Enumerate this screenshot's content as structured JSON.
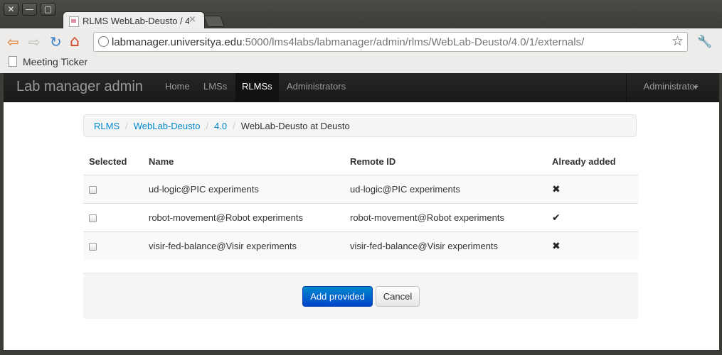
{
  "window": {
    "close_glyph": "✕",
    "minimize_glyph": "—",
    "maximize_glyph": "▢"
  },
  "tab": {
    "title": "RLMS WebLab-Deusto / 4.",
    "close_glyph": "×"
  },
  "toolbar": {
    "back_glyph": "⇦",
    "forward_glyph": "⇨",
    "reload_glyph": "↻",
    "home_glyph": "⌂",
    "url_host": "labmanager.universitya.edu",
    "url_path": ":5000/lms4labs/labmanager/admin/rlms/WebLab-Deusto/4.0/1/externals/",
    "star_glyph": "☆",
    "wrench_glyph": "🔧",
    "icons": [
      "back-arrow-icon",
      "forward-arrow-icon",
      "reload-icon",
      "home-icon",
      "globe-icon",
      "star-icon",
      "wrench-icon"
    ],
    "colors": {
      "back": "#e0792a",
      "forward": "#bdbdb8",
      "reload": "#3a7ec6",
      "home": "#d04a2a"
    }
  },
  "bookmarks": [
    {
      "label": "Meeting Ticker",
      "icon": "page-icon"
    }
  ],
  "navbar": {
    "brand": "Lab manager admin",
    "links": [
      "Home",
      "LMSs",
      "RLMSs",
      "Administrators"
    ],
    "active": "RLMSs",
    "user_menu": "Administrator"
  },
  "breadcrumb": {
    "items": [
      "RLMS",
      "WebLab-Deusto",
      "4.0"
    ],
    "current": "WebLab-Deusto at Deusto",
    "separator": "/"
  },
  "table": {
    "headers": [
      "Selected",
      "Name",
      "Remote ID",
      "Already added"
    ],
    "rows": [
      {
        "selected": false,
        "name": "ud-logic@PIC experiments",
        "remote_id": "ud-logic@PIC experiments",
        "already_added": false,
        "mark": "✖"
      },
      {
        "selected": false,
        "name": "robot-movement@Robot experiments",
        "remote_id": "robot-movement@Robot experiments",
        "already_added": true,
        "mark": "✔"
      },
      {
        "selected": false,
        "name": "visir-fed-balance@Visir experiments",
        "remote_id": "visir-fed-balance@Visir experiments",
        "already_added": false,
        "mark": "✖"
      }
    ]
  },
  "actions": {
    "submit_label": "Add provided",
    "cancel_label": "Cancel"
  },
  "colors": {
    "link": "#0088cc",
    "primary_top": "#0088cc",
    "primary_bottom": "#0044cc",
    "navbar": "#222222"
  }
}
